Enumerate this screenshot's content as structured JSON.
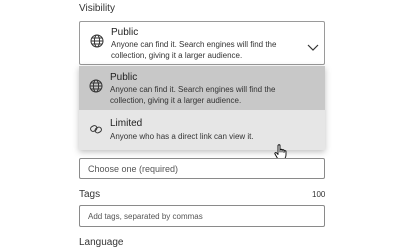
{
  "visibility": {
    "label": "Visibility",
    "selected": {
      "title": "Public",
      "desc_line1": "Anyone can find it. Search engines will find the",
      "desc_line2": "collection, giving it a larger audience.",
      "icon": "globe-icon"
    },
    "options": [
      {
        "title": "Public",
        "desc_line1": "Anyone can find it. Search engines will find the",
        "desc_line2": "collection, giving it a larger audience.",
        "icon": "globe-icon"
      },
      {
        "title": "Limited",
        "desc_line1": "Anyone who has a direct link can view it.",
        "icon": "link-icon"
      }
    ]
  },
  "category": {
    "placeholder": "Choose one (required)"
  },
  "tags": {
    "label": "Tags",
    "counter": "100",
    "placeholder": "Add tags, separated by commas"
  },
  "language": {
    "label": "Language"
  },
  "colors": {
    "selected_bg": "#c8c8c8",
    "hover_bg": "#e6e6e6",
    "border": "#9a9a9a"
  }
}
